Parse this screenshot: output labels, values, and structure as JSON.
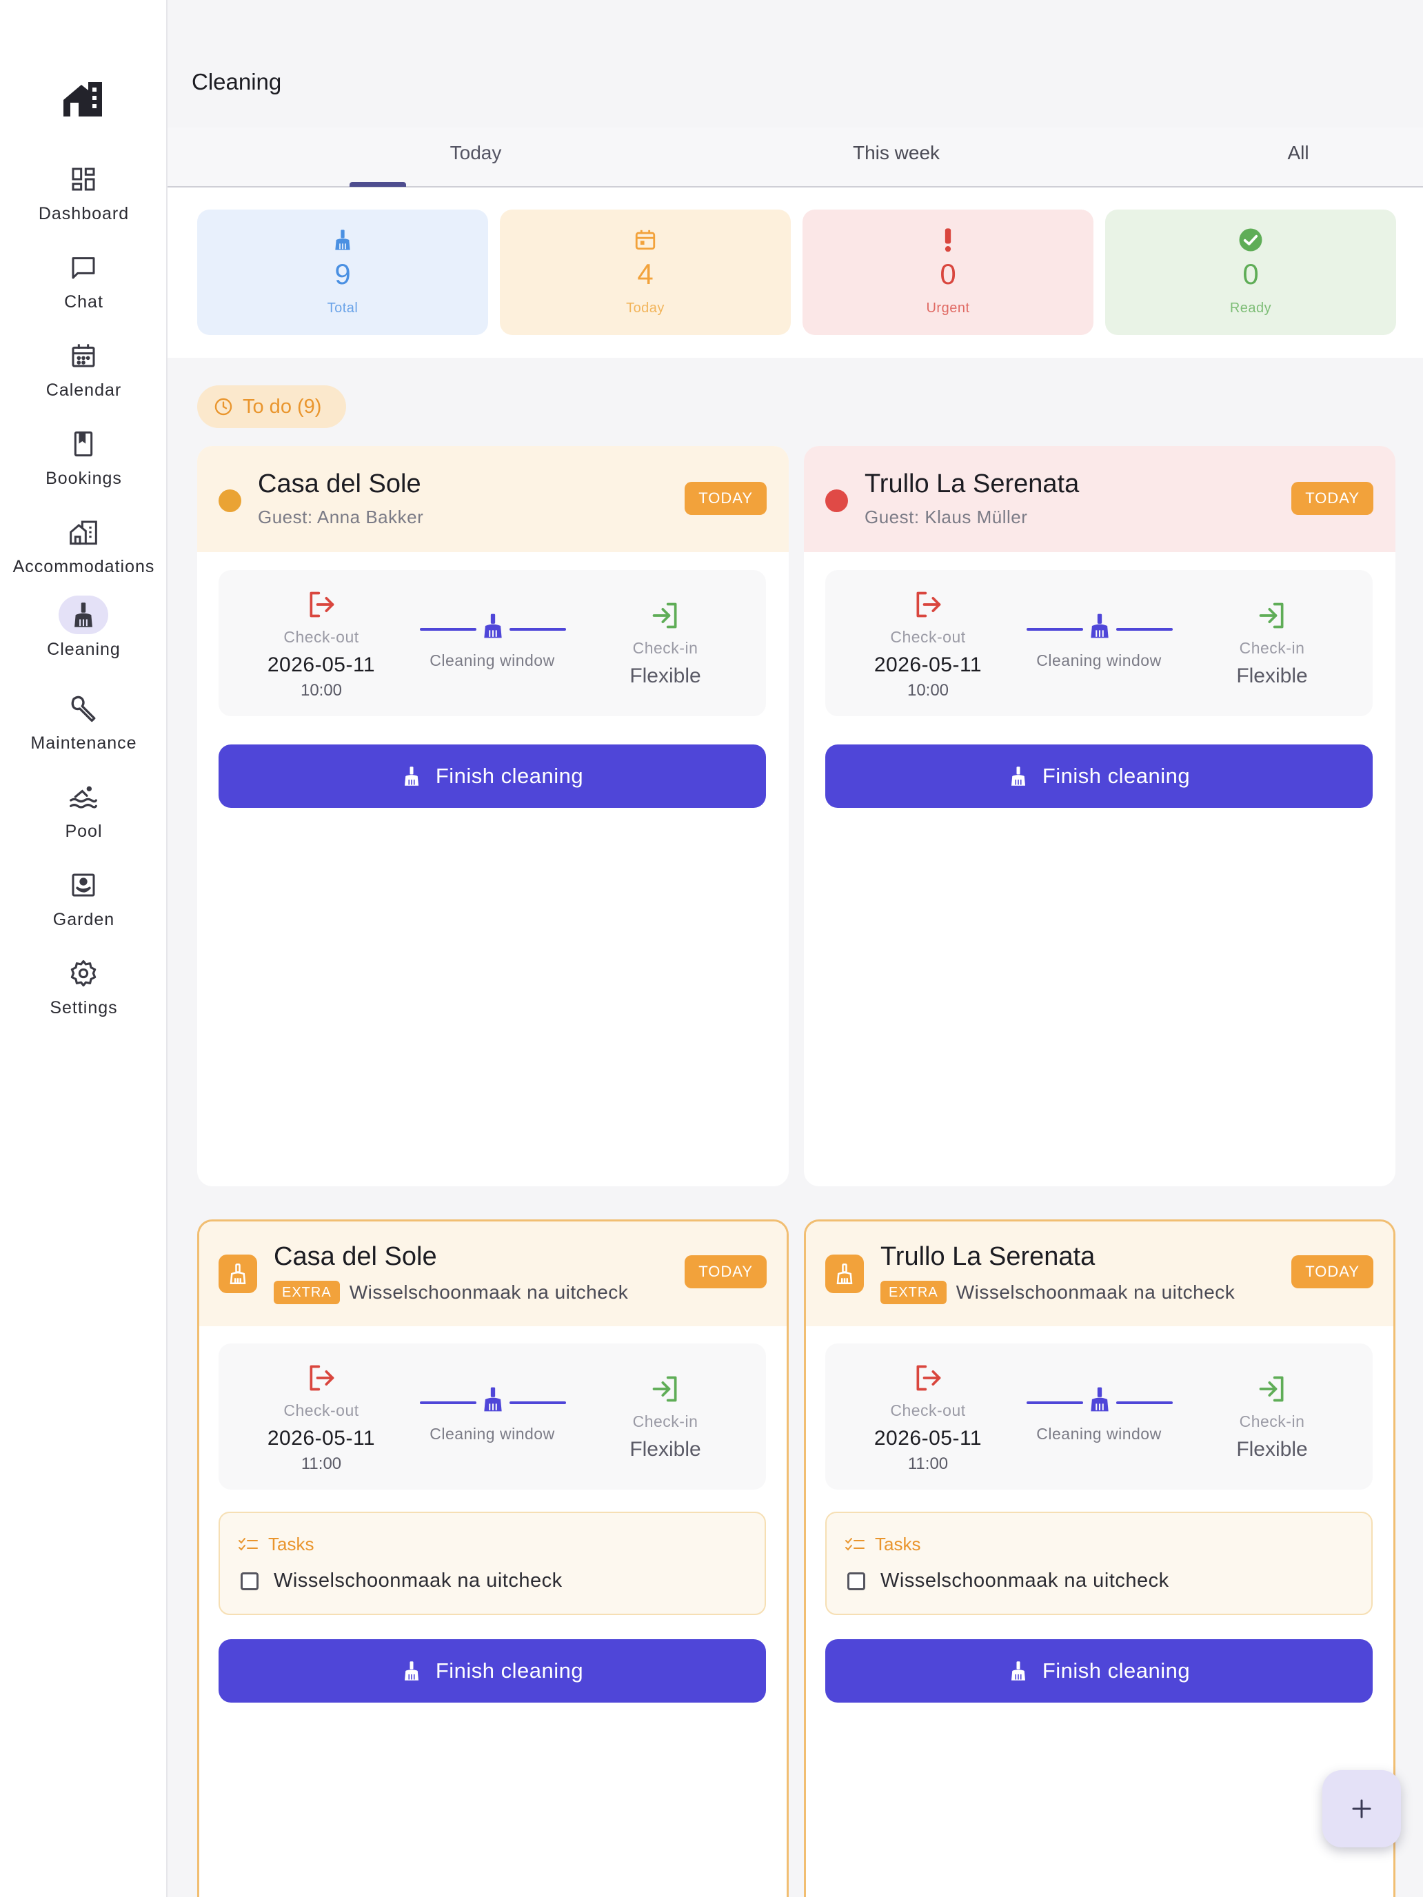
{
  "header": {
    "title": "Cleaning"
  },
  "tabs": [
    {
      "label": "Today"
    },
    {
      "label": "This week"
    },
    {
      "label": "All"
    }
  ],
  "sidebar": {
    "items": [
      {
        "label": "Dashboard",
        "icon": "dashboard-icon"
      },
      {
        "label": "Chat",
        "icon": "chat-icon"
      },
      {
        "label": "Calendar",
        "icon": "calendar-icon"
      },
      {
        "label": "Bookings",
        "icon": "bookings-icon"
      },
      {
        "label": "Accommodations",
        "icon": "accommodations-icon"
      },
      {
        "label": "Cleaning",
        "icon": "broom-icon",
        "active": true
      },
      {
        "label": "Maintenance",
        "icon": "wrench-icon"
      },
      {
        "label": "Pool",
        "icon": "pool-icon"
      },
      {
        "label": "Garden",
        "icon": "garden-icon"
      },
      {
        "label": "Settings",
        "icon": "gear-icon"
      }
    ]
  },
  "stats": [
    {
      "value": "9",
      "label": "Total",
      "color": "#4a90e2",
      "bg": "#e8f0fc"
    },
    {
      "value": "4",
      "label": "Today",
      "color": "#f2a23b",
      "bg": "#fdf0dc"
    },
    {
      "value": "0",
      "label": "Urgent",
      "color": "#d9463e",
      "bg": "#fbe7e7"
    },
    {
      "value": "0",
      "label": "Ready",
      "color": "#5fad57",
      "bg": "#e9f3e6"
    }
  ],
  "filter": {
    "label": "To do (9)"
  },
  "cards": [
    {
      "title": "Casa del Sole",
      "subtitle": "Guest: Anna Bakker",
      "badge": "TODAY",
      "checkout_caption": "Check-out",
      "checkout_date": "2026-05-11",
      "checkout_time": "10:00",
      "window_caption": "Cleaning window",
      "checkin_caption": "Check-in",
      "checkin_value": "Flexible",
      "button": "Finish cleaning",
      "dot_color": "#eaa334"
    },
    {
      "title": "Trullo La Serenata",
      "subtitle": "Guest: Klaus Müller",
      "badge": "TODAY",
      "checkout_caption": "Check-out",
      "checkout_date": "2026-05-11",
      "checkout_time": "10:00",
      "window_caption": "Cleaning window",
      "checkin_caption": "Check-in",
      "checkin_value": "Flexible",
      "button": "Finish cleaning",
      "dot_color": "#e04a46"
    },
    {
      "title": "Casa del Sole",
      "extra_badge": "EXTRA",
      "extra_desc": "Wisselschoonmaak na uitcheck",
      "badge": "TODAY",
      "checkout_caption": "Check-out",
      "checkout_date": "2026-05-11",
      "checkout_time": "11:00",
      "window_caption": "Cleaning window",
      "checkin_caption": "Check-in",
      "checkin_value": "Flexible",
      "tasks_title": "Tasks",
      "task": "Wisselschoonmaak na uitcheck",
      "button": "Finish cleaning"
    },
    {
      "title": "Trullo La Serenata",
      "extra_badge": "EXTRA",
      "extra_desc": "Wisselschoonmaak na uitcheck",
      "badge": "TODAY",
      "checkout_caption": "Check-out",
      "checkout_date": "2026-05-11",
      "checkout_time": "11:00",
      "window_caption": "Cleaning window",
      "checkin_caption": "Check-in",
      "checkin_value": "Flexible",
      "tasks_title": "Tasks",
      "task": "Wisselschoonmaak na uitcheck",
      "button": "Finish cleaning"
    }
  ],
  "colors": {
    "primary": "#4f46d8",
    "accent": "#f2a23b",
    "checkout": "#d9463e",
    "checkin": "#5fad57"
  }
}
